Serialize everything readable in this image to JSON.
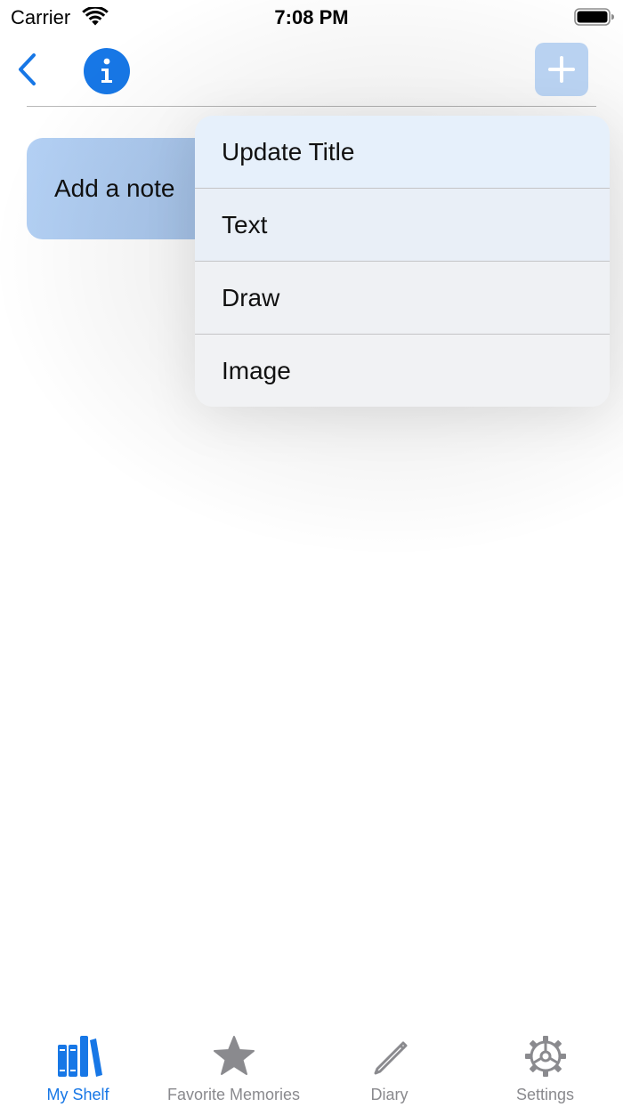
{
  "status_bar": {
    "carrier": "Carrier",
    "time": "7:08 PM"
  },
  "nav": {
    "back_icon": "chevron-left-icon",
    "info_icon": "info-icon",
    "add_icon": "plus-icon"
  },
  "note_card": {
    "label": "Add a note"
  },
  "menu": {
    "items": [
      {
        "label": "Update Title"
      },
      {
        "label": "Text"
      },
      {
        "label": "Draw"
      },
      {
        "label": "Image"
      }
    ]
  },
  "tab_bar": {
    "tabs": [
      {
        "label": "My Shelf",
        "icon": "books-icon",
        "active": true
      },
      {
        "label": "Favorite Memories",
        "icon": "star-icon",
        "active": false
      },
      {
        "label": "Diary",
        "icon": "pencil-icon",
        "active": false
      },
      {
        "label": "Settings",
        "icon": "gear-icon",
        "active": false
      }
    ]
  },
  "colors": {
    "accent": "#1777e6",
    "inactive": "#8a8a8e",
    "note_card": "#b3d0f4",
    "add_button_disabled": "#b9d2f1"
  }
}
